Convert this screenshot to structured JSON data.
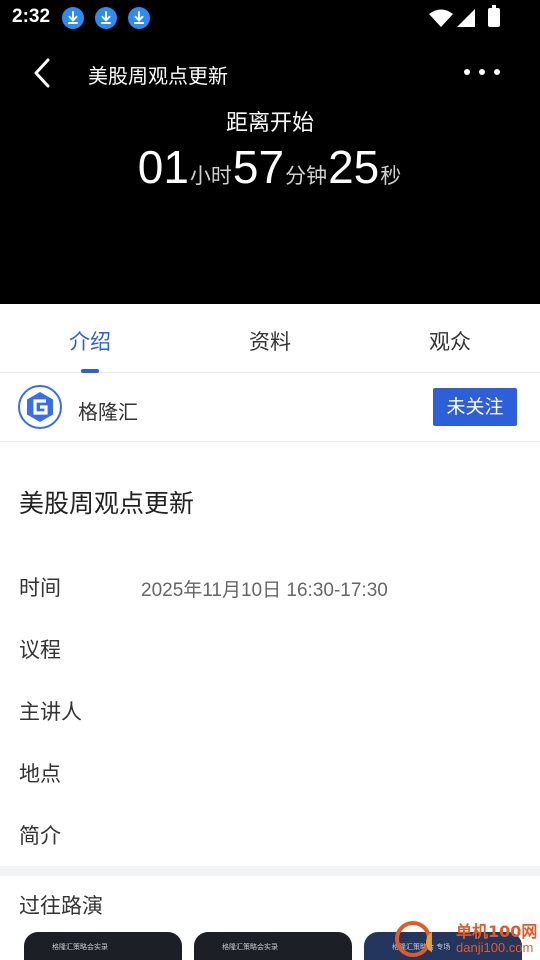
{
  "status_bar": {
    "time": "2:32",
    "notification_icons": [
      "download-icon",
      "download-icon",
      "download-icon"
    ],
    "system_icons": [
      "wifi-icon",
      "signal-icon",
      "battery-icon"
    ]
  },
  "nav": {
    "back_icon": "chevron-left-icon",
    "title": "美股周观点更新",
    "more_icon": "more-horizontal-icon"
  },
  "countdown": {
    "label": "距离开始",
    "hours": "01",
    "hours_unit": "小时",
    "minutes": "57",
    "minutes_unit": "分钟",
    "seconds": "25",
    "seconds_unit": "秒"
  },
  "tabs": [
    {
      "label": "介绍",
      "active": true
    },
    {
      "label": "资料",
      "active": false
    },
    {
      "label": "观众",
      "active": false
    }
  ],
  "organizer": {
    "name": "格隆汇",
    "follow_label": "未关注"
  },
  "event": {
    "title": "美股周观点更新",
    "rows": [
      {
        "label": "时间",
        "value": "2025年11月10日 16:30-17:30"
      },
      {
        "label": "议程",
        "value": ""
      },
      {
        "label": "主讲人",
        "value": ""
      },
      {
        "label": "地点",
        "value": ""
      },
      {
        "label": "简介",
        "value": ""
      }
    ]
  },
  "past": {
    "title": "过往路演",
    "thumbnails": [
      {
        "caption": "格隆汇策略会实录"
      },
      {
        "caption": "格隆汇策略会实录"
      },
      {
        "caption": "格隆汇策略会 专场"
      }
    ]
  },
  "watermark": {
    "line1": "单机100网",
    "line2": "danji100.com"
  },
  "colors": {
    "accent": "#2f5fd8",
    "header_bg": "#000000",
    "download_badge": "#2d8cf0"
  }
}
